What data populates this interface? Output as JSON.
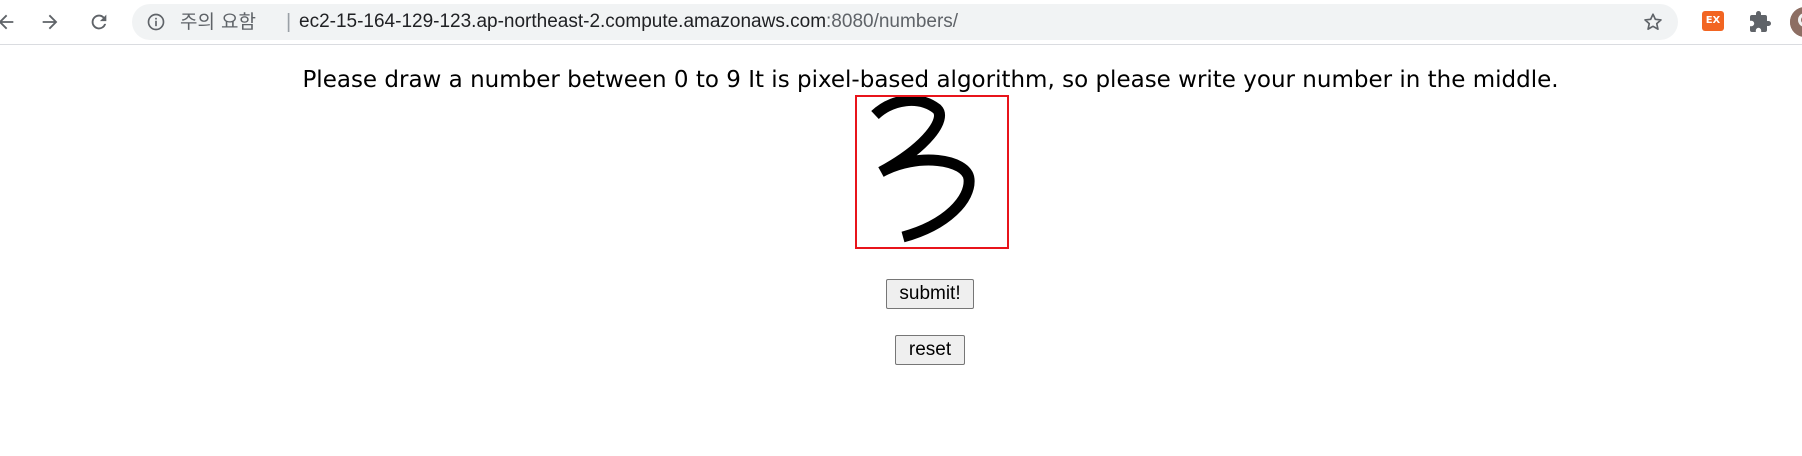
{
  "browser": {
    "security_warning": "주의 요함",
    "url_host": "ec2-15-164-129-123.ap-northeast-2.compute.amazonaws.com",
    "url_rest": ":8080/numbers/",
    "extension_label": "EX",
    "icons": [
      "back-icon",
      "forward-icon",
      "reload-icon",
      "info-icon",
      "star-icon",
      "puzzle-icon",
      "avatar"
    ]
  },
  "page": {
    "instructions": "Please draw a number between 0 to 9 It is pixel-based algorithm, so please write your number in the middle.",
    "canvas_border_color": "#e8141b",
    "drawn_digit": "3",
    "submit_label": "submit!",
    "reset_label": "reset"
  }
}
